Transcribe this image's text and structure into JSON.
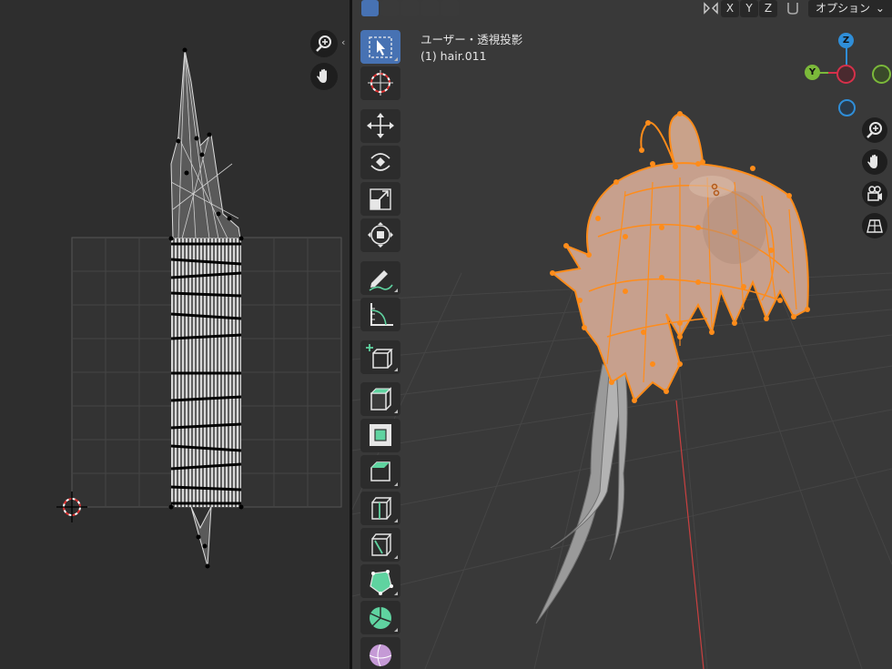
{
  "viewport": {
    "view_name": "ユーザー・透視投影",
    "object_name": "(1) hair.011",
    "options_label": "オプション",
    "options_chevron": "⌄",
    "axis_buttons": [
      "X",
      "Y",
      "Z"
    ]
  },
  "gizmo": {
    "z": "Z",
    "y": "Y"
  },
  "icons": {
    "uv_zoom": "zoom-in-icon",
    "uv_pan": "hand-icon",
    "vp_zoom": "zoom-in-icon",
    "vp_pan": "hand-icon",
    "vp_camera": "camera-icon",
    "vp_grid": "grid-icon"
  },
  "colors": {
    "selection": "#ff8c1a",
    "active_tool": "#4772b3",
    "gizmo_x": "#d6304a",
    "gizmo_y": "#7bb93a",
    "gizmo_z": "#2f8ed8"
  }
}
